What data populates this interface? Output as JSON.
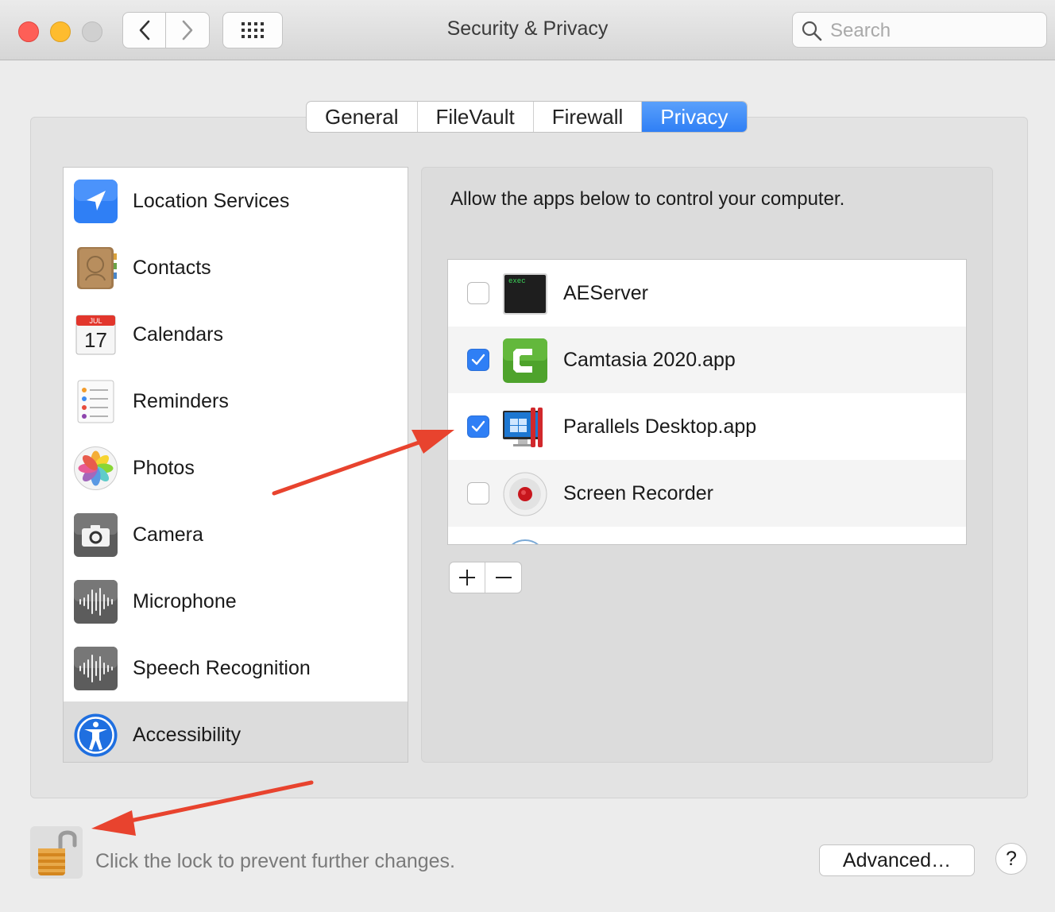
{
  "window": {
    "title": "Security & Privacy",
    "search_placeholder": "Search"
  },
  "tabs": [
    {
      "label": "General"
    },
    {
      "label": "FileVault"
    },
    {
      "label": "Firewall"
    },
    {
      "label": "Privacy",
      "active": true
    }
  ],
  "sidebar": {
    "items": [
      {
        "label": "Location Services",
        "icon": "location-arrow-icon"
      },
      {
        "label": "Contacts",
        "icon": "contacts-book-icon"
      },
      {
        "label": "Calendars",
        "icon": "calendar-icon",
        "icon_month": "JUL",
        "icon_day": "17"
      },
      {
        "label": "Reminders",
        "icon": "reminders-list-icon"
      },
      {
        "label": "Photos",
        "icon": "photos-flower-icon"
      },
      {
        "label": "Camera",
        "icon": "camera-icon"
      },
      {
        "label": "Microphone",
        "icon": "microphone-waveform-icon"
      },
      {
        "label": "Speech Recognition",
        "icon": "speech-waveform-icon"
      },
      {
        "label": "Accessibility",
        "icon": "accessibility-icon",
        "selected": true
      }
    ]
  },
  "privacy": {
    "description": "Allow the apps below to control your computer.",
    "apps": [
      {
        "name": "AEServer",
        "checked": false,
        "icon": "terminal-exec-icon",
        "icon_text": "exec"
      },
      {
        "name": "Camtasia 2020.app",
        "checked": true,
        "icon": "camtasia-icon"
      },
      {
        "name": "Parallels Desktop.app",
        "checked": true,
        "icon": "parallels-icon"
      },
      {
        "name": "Screen Recorder",
        "checked": false,
        "icon": "screen-recorder-icon"
      }
    ],
    "add_label": "+",
    "remove_label": "−"
  },
  "footer": {
    "lock_text": "Click the lock to prevent further changes.",
    "advanced_label": "Advanced…",
    "help_label": "?"
  },
  "colors": {
    "accent": "#2f7ff5",
    "annotation_arrow": "#e8432e"
  }
}
